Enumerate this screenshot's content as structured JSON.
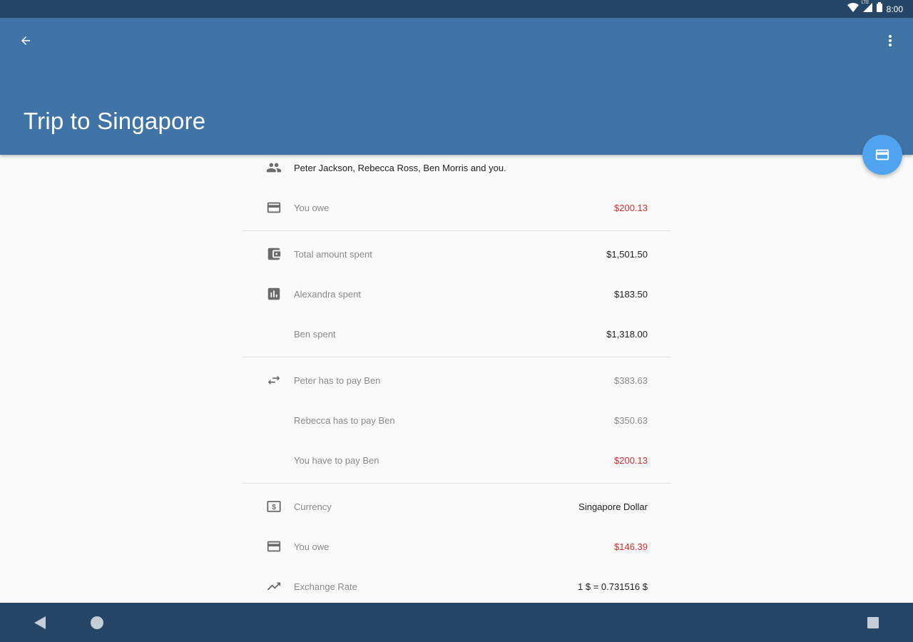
{
  "status_bar": {
    "time": "8:00",
    "network": "LTE"
  },
  "app_bar": {
    "title": "Trip to Singapore"
  },
  "colors": {
    "primary": "#4174a6",
    "primary_dark": "#264667",
    "accent": "#4fa3ef",
    "negative": "#d32f2f"
  },
  "sections": [
    {
      "rows": [
        {
          "icon": "people-icon",
          "label": "Peter Jackson, Rebecca Ross, Ben Morris and you.",
          "value": ""
        },
        {
          "icon": "credit-card-icon",
          "label": "You owe",
          "value": "$200.13"
        }
      ]
    },
    {
      "rows": [
        {
          "icon": "wallet-icon",
          "label": "Total amount spent",
          "value": "$1,501.50"
        },
        {
          "icon": "bar-chart-icon",
          "label": "Alexandra spent",
          "value": "$183.50"
        },
        {
          "icon": "",
          "label": "Ben spent",
          "value": "$1,318.00"
        }
      ]
    },
    {
      "rows": [
        {
          "icon": "swap-icon",
          "label": "Peter has to pay Ben",
          "value": "$383.63"
        },
        {
          "icon": "",
          "label": "Rebecca has to pay Ben",
          "value": "$350.63"
        },
        {
          "icon": "",
          "label": "You have to pay Ben",
          "value": "$200.13"
        }
      ]
    },
    {
      "rows": [
        {
          "icon": "currency-icon",
          "label": "Currency",
          "value": "Singapore Dollar"
        },
        {
          "icon": "credit-card-icon",
          "label": "You owe",
          "value": "$146.39"
        },
        {
          "icon": "trending-up-icon",
          "label": "Exchange Rate",
          "value": "1 $ = 0.731516 $"
        }
      ]
    }
  ]
}
